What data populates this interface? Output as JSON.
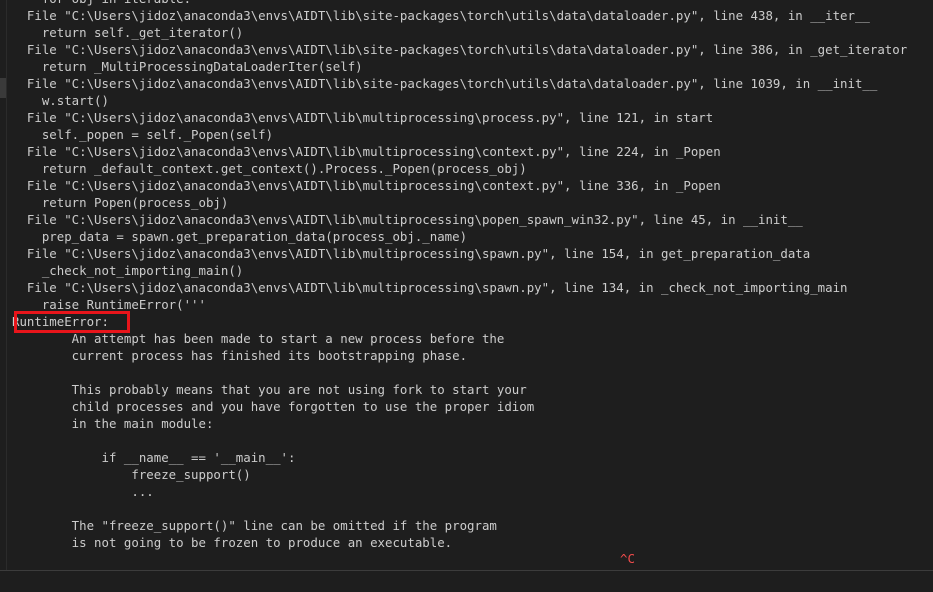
{
  "terminal": {
    "lines": [
      "    for obj in iterable:",
      "  File \"C:\\Users\\jidoz\\anaconda3\\envs\\AIDT\\lib\\site-packages\\torch\\utils\\data\\dataloader.py\", line 438, in __iter__",
      "    return self._get_iterator()",
      "  File \"C:\\Users\\jidoz\\anaconda3\\envs\\AIDT\\lib\\site-packages\\torch\\utils\\data\\dataloader.py\", line 386, in _get_iterator",
      "    return _MultiProcessingDataLoaderIter(self)",
      "  File \"C:\\Users\\jidoz\\anaconda3\\envs\\AIDT\\lib\\site-packages\\torch\\utils\\data\\dataloader.py\", line 1039, in __init__",
      "    w.start()",
      "  File \"C:\\Users\\jidoz\\anaconda3\\envs\\AIDT\\lib\\multiprocessing\\process.py\", line 121, in start",
      "    self._popen = self._Popen(self)",
      "  File \"C:\\Users\\jidoz\\anaconda3\\envs\\AIDT\\lib\\multiprocessing\\context.py\", line 224, in _Popen",
      "    return _default_context.get_context().Process._Popen(process_obj)",
      "  File \"C:\\Users\\jidoz\\anaconda3\\envs\\AIDT\\lib\\multiprocessing\\context.py\", line 336, in _Popen",
      "    return Popen(process_obj)",
      "  File \"C:\\Users\\jidoz\\anaconda3\\envs\\AIDT\\lib\\multiprocessing\\popen_spawn_win32.py\", line 45, in __init__",
      "    prep_data = spawn.get_preparation_data(process_obj._name)",
      "  File \"C:\\Users\\jidoz\\anaconda3\\envs\\AIDT\\lib\\multiprocessing\\spawn.py\", line 154, in get_preparation_data",
      "    _check_not_importing_main()",
      "  File \"C:\\Users\\jidoz\\anaconda3\\envs\\AIDT\\lib\\multiprocessing\\spawn.py\", line 134, in _check_not_importing_main",
      "    raise RuntimeError('''",
      "RuntimeError:",
      "        An attempt has been made to start a new process before the",
      "        current process has finished its bootstrapping phase.",
      "",
      "        This probably means that you are not using fork to start your",
      "        child processes and you have forgotten to use the proper idiom",
      "        in the main module:",
      "",
      "            if __name__ == '__main__':",
      "                freeze_support()",
      "                ...",
      "",
      "        The \"freeze_support()\" line can be omitted if the program",
      "        is not going to be frozen to produce an executable."
    ],
    "interrupt": "^C"
  },
  "colors": {
    "background": "#1e1e1e",
    "text": "#cccccc",
    "highlight_box": "#e8151b",
    "interrupt": "#f14c4c"
  }
}
